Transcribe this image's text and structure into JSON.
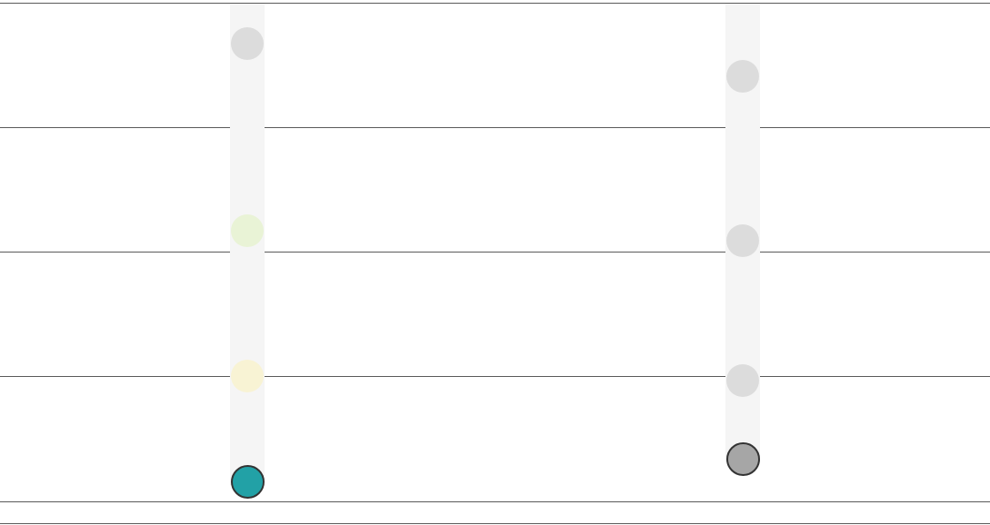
{
  "rows": [
    {
      "id": "row-1"
    },
    {
      "id": "row-2"
    },
    {
      "id": "row-3"
    },
    {
      "id": "row-4"
    }
  ],
  "columns": [
    {
      "id": "column-left",
      "markers": [
        {
          "id": "left-marker-row-1",
          "state": "faded",
          "color": "#dcdcdc"
        },
        {
          "id": "left-marker-row-2",
          "state": "faded",
          "color": "#e9f3d6"
        },
        {
          "id": "left-marker-row-3",
          "state": "faded",
          "color": "#f8f3d4"
        },
        {
          "id": "left-marker-row-4",
          "state": "active",
          "color": "#22a1a6",
          "outline": "#333333"
        }
      ]
    },
    {
      "id": "column-right",
      "markers": [
        {
          "id": "right-marker-row-1",
          "state": "faded",
          "color": "#dcdcdc"
        },
        {
          "id": "right-marker-row-2",
          "state": "faded",
          "color": "#dcdcdc"
        },
        {
          "id": "right-marker-row-3",
          "state": "faded",
          "color": "#dcdcdc"
        },
        {
          "id": "right-marker-row-4",
          "state": "active",
          "color": "#a6a6a6",
          "outline": "#333333"
        }
      ]
    }
  ]
}
